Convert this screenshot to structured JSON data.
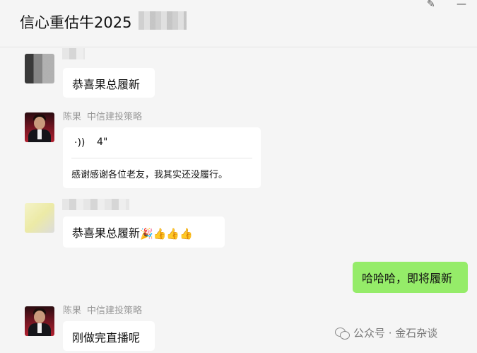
{
  "header": {
    "title": "信心重估牛2025"
  },
  "messages": [
    {
      "kind": "text",
      "side": "left",
      "text": "恭喜果总履新"
    },
    {
      "kind": "voice",
      "side": "left",
      "sender_name": "陈果",
      "sender_org": "中信建投策略",
      "duration": "4\"",
      "transcript": "感谢感谢各位老友，我其实还没履行。"
    },
    {
      "kind": "text",
      "side": "left",
      "text": "恭喜果总履新",
      "emojis": "🎉👍👍👍"
    },
    {
      "kind": "text",
      "side": "right",
      "text": "哈哈哈，即将履新"
    },
    {
      "kind": "text",
      "side": "left",
      "sender_name": "陈果",
      "sender_org": "中信建投策略",
      "text": "刚做完直播呢"
    }
  ],
  "icons": {
    "pin": "pin-icon",
    "minimize": "minimize-icon",
    "voice": "voice-wave-icon",
    "watermark": "wechat-icon"
  },
  "watermark": {
    "text": "公众号 · 金石杂谈"
  },
  "colors": {
    "self_bubble": "#95ec69",
    "other_bubble": "#ffffff",
    "background": "#f5f5f5"
  }
}
